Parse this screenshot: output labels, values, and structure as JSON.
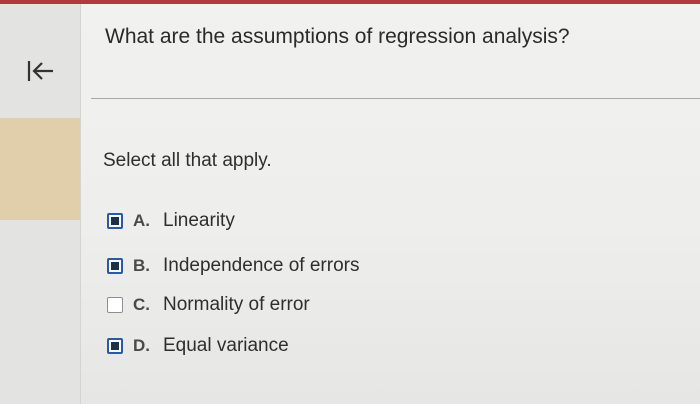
{
  "question": {
    "text": "What are the assumptions of regression analysis?"
  },
  "instruction": "Select all that apply.",
  "options": [
    {
      "letter": "A.",
      "text": "Linearity",
      "checked": true
    },
    {
      "letter": "B.",
      "text": "Independence of errors",
      "checked": true
    },
    {
      "letter": "C.",
      "text": "Normality of error",
      "checked": false
    },
    {
      "letter": "D.",
      "text": "Equal variance",
      "checked": true
    }
  ],
  "sidebar": {
    "back_icon": "back-to-start-arrow-icon"
  },
  "colors": {
    "top_strip": "#b03a3e",
    "sidebar_highlight": "#e0cfaa",
    "checkbox_border_checked": "#2c5aa0",
    "checkbox_fill_checked": "#1f2f4a"
  }
}
